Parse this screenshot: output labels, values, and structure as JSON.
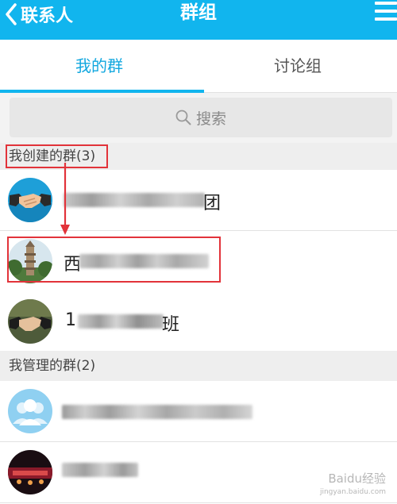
{
  "header": {
    "back_label": "联系人",
    "title": "群组"
  },
  "tabs": {
    "active": "我的群",
    "inactive": "讨论组"
  },
  "search": {
    "placeholder": "搜索"
  },
  "sections": {
    "created": "我创建的群(3)",
    "managed": "我管理的群(2)"
  },
  "rows": [
    {
      "avatar": "handshake-avatar",
      "suffix": "团"
    },
    {
      "avatar": "pagoda-avatar",
      "prefix": "西"
    },
    {
      "avatar": "handshake-avatar",
      "prefix": "1",
      "suffix": "班"
    },
    {
      "avatar": "default-group-avatar"
    },
    {
      "avatar": "stage-photo-avatar"
    }
  ],
  "watermark": {
    "brand": "Baidu经验",
    "url": "jingyan.baidu.com"
  },
  "colors": {
    "header": "#11b5ee",
    "tab_active": "#11a7df",
    "annotation": "#e2333a"
  }
}
